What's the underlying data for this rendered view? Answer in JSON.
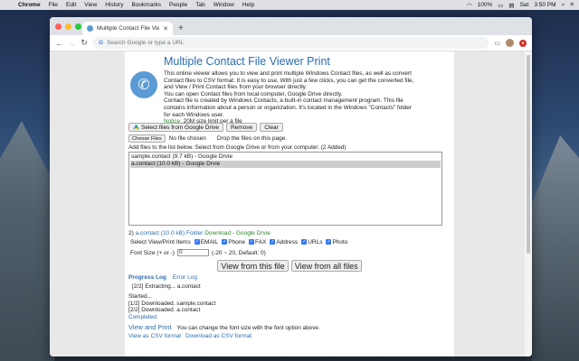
{
  "menubar": {
    "app": "Chrome",
    "items": [
      "File",
      "Edit",
      "View",
      "History",
      "Bookmarks",
      "People",
      "Tab",
      "Window",
      "Help"
    ],
    "battery": "100%",
    "day": "Sat",
    "time": "3:50 PM"
  },
  "browser": {
    "tab_title": "Multiple Contact File Viewer Pr",
    "newtab": "+",
    "omnibox_placeholder": "Search Google or type a URL"
  },
  "page": {
    "title": "Multiple Contact File Viewer Print",
    "desc": [
      "This online viewer allows you to view and print multiple Windows Contact files, as well as convert",
      "Contact files to CSV format. It is easy to use, With just a few clicks, you can get the converted file,",
      "and View / Print Contact files from your browser directly.",
      "You can open Contact files from local computer, Google Drive directly.",
      "Contact file is created by Windows Contacts, a built-in contact management program. This file",
      "contains information about a person or organization. It's located in the Windows \"Contacts\" folder",
      "for each Windows user."
    ],
    "notice_label": "Notice:",
    "notice_text": " 20M size limit per a file",
    "buttons": {
      "drive": "Select files from Google Drive",
      "remove": "Remove",
      "clear": "Clear"
    },
    "choose_files": "Choose Files",
    "no_file": "No file chosen",
    "drop_text": "Drop the files on this page.",
    "add_line": "Add files to the list below. Select from Google Drive or from your computer. (2 Added)",
    "files": [
      {
        "label": "sample.contact (9.7 kB) - Google Drvie",
        "selected": false
      },
      {
        "label": "a.contact (10.0 kB) - Google Drvie",
        "selected": true
      }
    ],
    "selected": {
      "index": "2)",
      "name": "a.contact (10.0 kB)",
      "folder": "Folder",
      "download": "Download - Google Drvie"
    },
    "options_label": "Select View/Print Items",
    "options": [
      "EMAIL",
      "Phone",
      "FAX",
      "Address",
      "URLs",
      "Photo"
    ],
    "font_label": "Font Size (+ or -)",
    "font_value": "0",
    "font_hint": "(-20 ~ 20, Default: 0)",
    "view_this": "View from this file",
    "view_all": "View from all files",
    "progress_log": "Progress Log",
    "error_log": "Error Log",
    "log": {
      "extracting": "[2/2] Extracting... a.contact",
      "started": "Started...",
      "line1": "[1/2] Downloaded. sample.contact",
      "line2": "[2/2] Downloaded. a.contact",
      "completed": "Completed."
    },
    "view_print": "View and Print",
    "view_print_note": "You can change the font size with the font option above.",
    "view_csv": "View as CSV format",
    "download_csv": "Download as CSV format"
  }
}
